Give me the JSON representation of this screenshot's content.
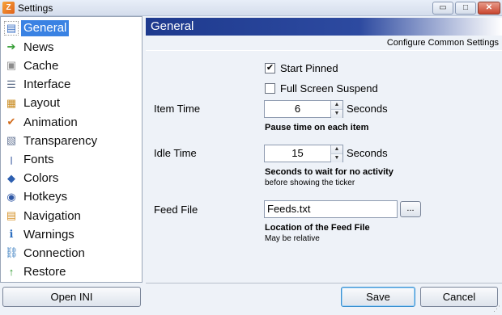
{
  "window": {
    "title": "Settings"
  },
  "sidebar": {
    "items": [
      {
        "label": "General",
        "icon": "general-icon",
        "glyph": "▤",
        "color": "#3a6fc4",
        "selected": true
      },
      {
        "label": "News",
        "icon": "arrow-right-icon",
        "glyph": "➔",
        "color": "#2f9a2f"
      },
      {
        "label": "Cache",
        "icon": "cache-icon",
        "glyph": "▣",
        "color": "#8c8c8c"
      },
      {
        "label": "Interface",
        "icon": "interface-icon",
        "glyph": "☰",
        "color": "#5d6d88"
      },
      {
        "label": "Layout",
        "icon": "layout-icon",
        "glyph": "▦",
        "color": "#c88a1e"
      },
      {
        "label": "Animation",
        "icon": "animation-icon",
        "glyph": "✔",
        "color": "#d26b1b"
      },
      {
        "label": "Transparency",
        "icon": "transparency-icon",
        "glyph": "▧",
        "color": "#6b7b99"
      },
      {
        "label": "Fonts",
        "icon": "fonts-icon",
        "glyph": "ꞁ",
        "color": "#4a69a8"
      },
      {
        "label": "Colors",
        "icon": "colors-icon",
        "glyph": "◆",
        "color": "#2d5fb0"
      },
      {
        "label": "Hotkeys",
        "icon": "hotkeys-icon",
        "glyph": "◉",
        "color": "#3058a5"
      },
      {
        "label": "Navigation",
        "icon": "navigation-icon",
        "glyph": "▤",
        "color": "#d6932a"
      },
      {
        "label": "Warnings",
        "icon": "warnings-icon",
        "glyph": "ℹ",
        "color": "#2d6fc0"
      },
      {
        "label": "Connection",
        "icon": "connection-icon",
        "glyph": "⛓",
        "color": "#3a7ec0"
      },
      {
        "label": "Restore",
        "icon": "restore-icon",
        "glyph": "↑",
        "color": "#2f9a2f"
      }
    ]
  },
  "main": {
    "header_title": "General",
    "subheader": "Configure Common Settings",
    "start_pinned": {
      "label": "Start Pinned",
      "checked": true
    },
    "full_screen_suspend": {
      "label": "Full Screen Suspend",
      "checked": false
    },
    "item_time": {
      "label": "Item Time",
      "value": "6",
      "unit": "Seconds",
      "help": "Pause time on each item"
    },
    "idle_time": {
      "label": "Idle Time",
      "value": "15",
      "unit": "Seconds",
      "help": "Seconds to wait for no activity",
      "help_small": "before showing the ticker"
    },
    "feed_file": {
      "label": "Feed File",
      "value": "Feeds.txt",
      "browse": "...",
      "help": "Location of the Feed File",
      "help_small": "May be relative"
    }
  },
  "buttons": {
    "open_ini": "Open INI",
    "save": "Save",
    "cancel": "Cancel"
  },
  "titlebar_buttons": {
    "minimize": "▭",
    "maximize": "□",
    "close": "✕"
  },
  "colors": {
    "header_blue": "#1e3a8e",
    "selection": "#3a82e3"
  }
}
